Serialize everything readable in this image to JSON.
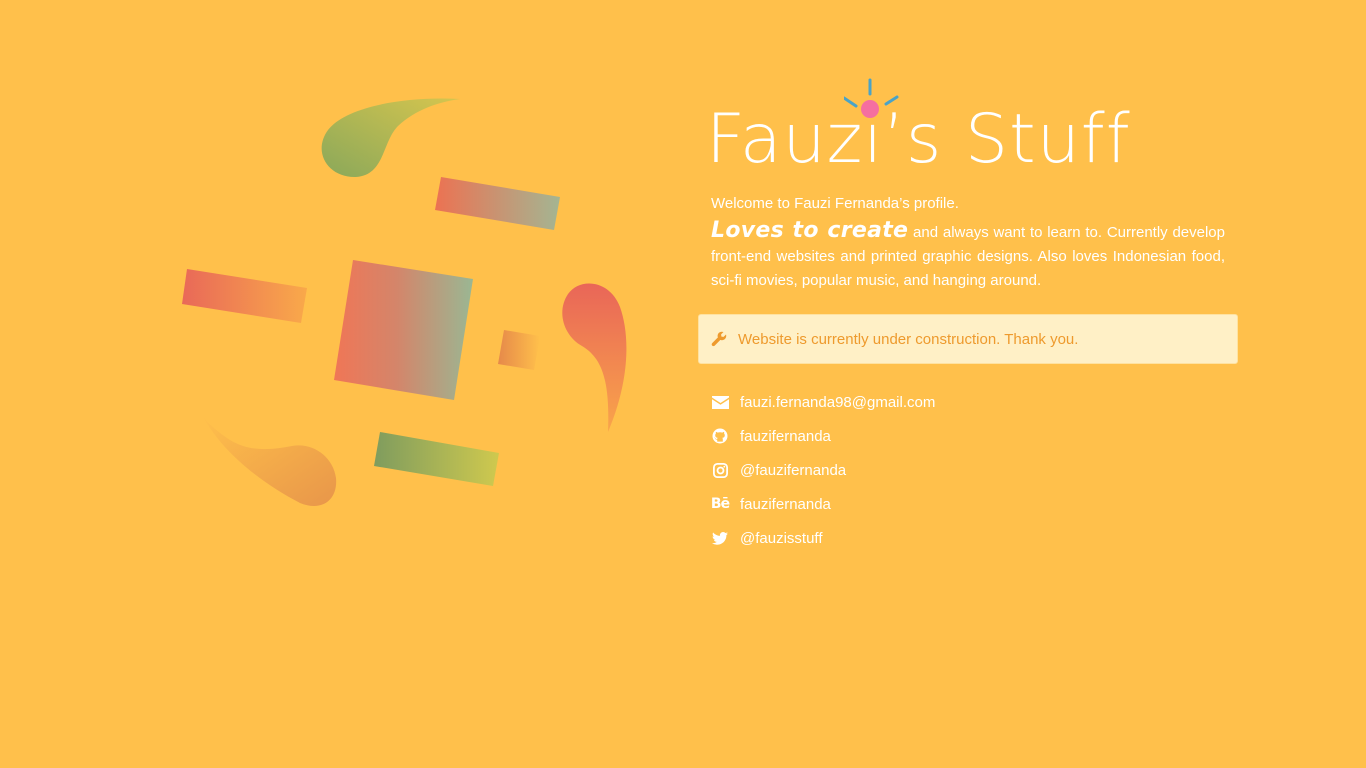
{
  "site": {
    "title": "Fauzi’s Stuff"
  },
  "intro": {
    "welcome": "Welcome to Fauzi Fernanda’s profile.",
    "emphasis": "Loves to create",
    "bio_rest": " and always want to learn to. Currently develop front-end websites and printed graphic designs. Also loves Indonesian food, sci-fi movies, popular music, and hanging around."
  },
  "notice": {
    "icon": "wrench-icon",
    "text": "Website is currently under construction. Thank you."
  },
  "contacts": [
    {
      "icon": "envelope-icon",
      "label": "fauzi.fernanda98@gmail.com"
    },
    {
      "icon": "github-icon",
      "label": "fauzifernanda"
    },
    {
      "icon": "instagram-icon",
      "label": "@fauzifernanda"
    },
    {
      "icon": "behance-icon",
      "glyph": "Bē",
      "label": "fauzifernanda"
    },
    {
      "icon": "twitter-icon",
      "label": "@fauzisstuff"
    }
  ],
  "colors": {
    "background": "#ffc04b",
    "text": "#ffffff",
    "notice_bg": "#fff0c6",
    "notice_text": "#ee9a2d",
    "sparkle_rays": "#4aa3c7",
    "sparkle_dot": "#f56fa0"
  }
}
